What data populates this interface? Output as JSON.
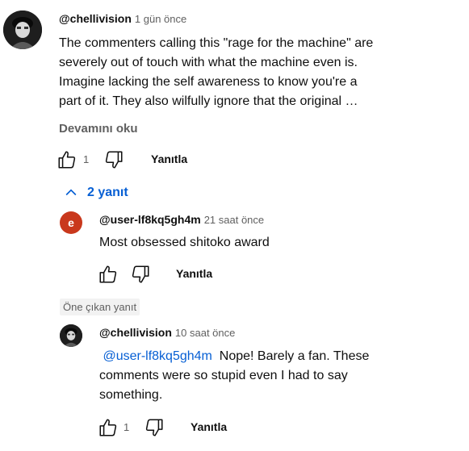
{
  "comment": {
    "author": "@chellivision",
    "time": "1 gün önce",
    "text_lines": [
      "The commenters calling this \"rage for the machine\" are",
      "severely out of touch with what the machine even is.",
      "Imagine lacking the self awareness to know you're a",
      "part of it. They also wilfully ignore that the original …"
    ],
    "read_more": "Devamını oku",
    "like_count": "1",
    "reply_label": "Yanıtla"
  },
  "replies_toggle": {
    "label": "2 yanıt",
    "icon": "chevron-up-icon"
  },
  "reply1": {
    "avatar_letter": "e",
    "avatar_color": "#c9381c",
    "author": "@user-lf8kq5gh4m",
    "time": "21 saat önce",
    "text": "Most obsessed shitoko award",
    "reply_label": "Yanıtla"
  },
  "pinned_chip": "Öne çıkan yanıt",
  "reply2": {
    "author": "@chellivision",
    "time": "10 saat önce",
    "mention": "@user-lf8kq5gh4m",
    "text_line1": "Nope! Barely a fan. These",
    "text_line2": "comments were so stupid even I had to say",
    "text_line3": "something.",
    "like_count": "1",
    "reply_label": "Yanıtla"
  }
}
